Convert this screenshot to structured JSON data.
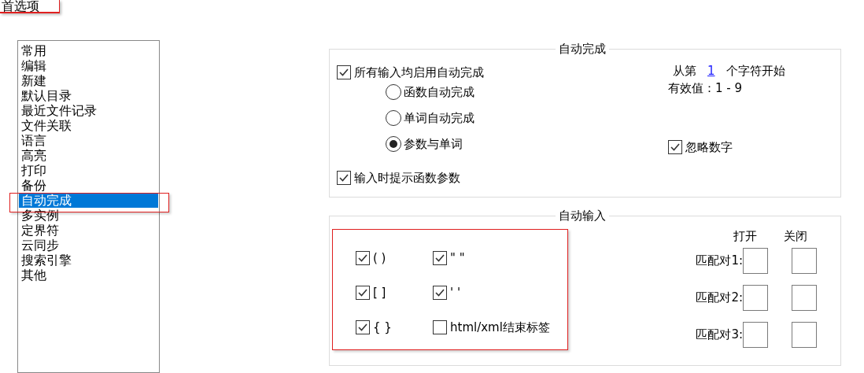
{
  "title_tab": "首选项",
  "sidebar": {
    "items": [
      {
        "label": "常用",
        "selected": false
      },
      {
        "label": "编辑",
        "selected": false
      },
      {
        "label": "新建",
        "selected": false
      },
      {
        "label": "默认目录",
        "selected": false
      },
      {
        "label": "最近文件记录",
        "selected": false
      },
      {
        "label": "文件关联",
        "selected": false
      },
      {
        "label": "语言",
        "selected": false
      },
      {
        "label": "高亮",
        "selected": false
      },
      {
        "label": "打印",
        "selected": false
      },
      {
        "label": "备份",
        "selected": false
      },
      {
        "label": "自动完成",
        "selected": true
      },
      {
        "label": "多实例",
        "selected": false
      },
      {
        "label": "定界符",
        "selected": false
      },
      {
        "label": "云同步",
        "selected": false
      },
      {
        "label": "搜索引擎",
        "selected": false
      },
      {
        "label": "其他",
        "selected": false
      }
    ]
  },
  "autocomplete": {
    "title": "自动完成",
    "enable_all": {
      "label": "所有输入均启用自动完成",
      "checked": true
    },
    "modes": [
      {
        "label": "函数自动完成",
        "selected": false
      },
      {
        "label": "单词自动完成",
        "selected": false
      },
      {
        "label": "参数与单词",
        "selected": true
      }
    ],
    "start_prefix": "从第",
    "start_value": "1",
    "start_suffix": "个字符开始",
    "valid_range": "有效值：1 - 9",
    "ignore_numbers": {
      "label": "忽略数字",
      "checked": true
    },
    "show_params": {
      "label": "输入时提示函数参数",
      "checked": true
    }
  },
  "auto_input": {
    "title": "自动输入",
    "pairs": [
      {
        "label": "( )",
        "checked": true
      },
      {
        "label": "\" \"",
        "checked": true
      },
      {
        "label": "[ ]",
        "checked": true
      },
      {
        "label": "' '",
        "checked": true
      },
      {
        "label": "{ }",
        "checked": true
      },
      {
        "label": "html/xml结束标签",
        "checked": false
      }
    ],
    "headers": [
      "打开",
      "关闭"
    ],
    "match_pairs": [
      "匹配对1:",
      "匹配对2:",
      "匹配对3:"
    ]
  }
}
